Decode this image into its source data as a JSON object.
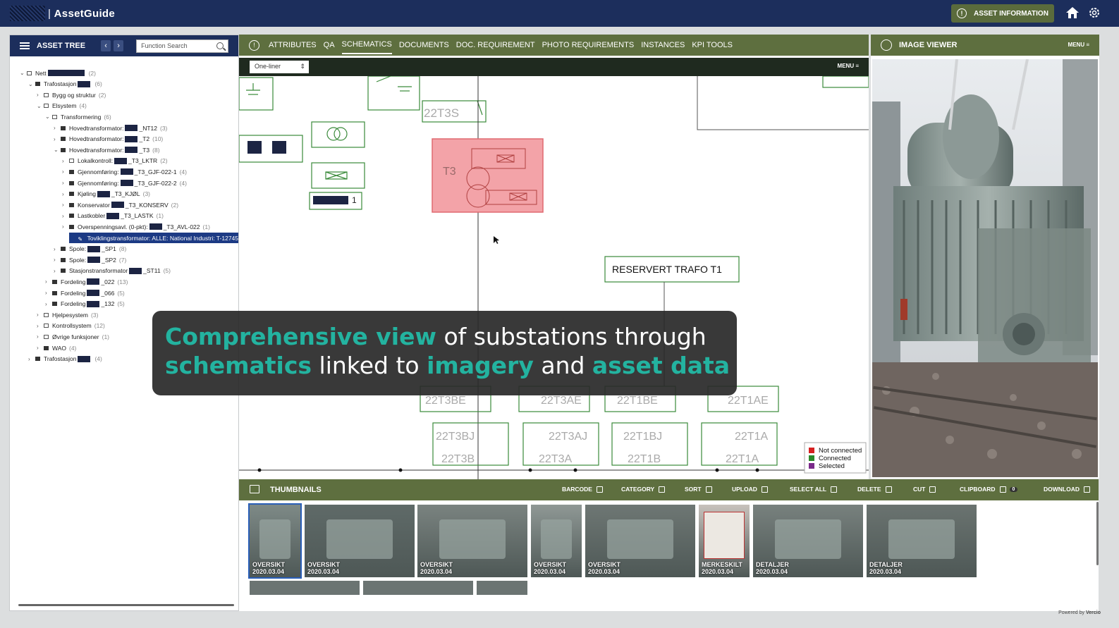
{
  "app": {
    "title": "AssetGuide"
  },
  "header": {
    "asset_info_label": "ASSET INFORMATION"
  },
  "asset_tree": {
    "title": "ASSET TREE",
    "search_placeholder": "Function Search",
    "items": [
      {
        "label": "Nett",
        "count": "(2)"
      },
      {
        "label": "Trafostasjon",
        "count": "(6)"
      },
      {
        "label": "Bygg og struktur",
        "count": "(2)"
      },
      {
        "label": "Elsystem",
        "count": "(4)"
      },
      {
        "label": "Transformering",
        "count": "(6)"
      },
      {
        "label": "Hovedtransformator:",
        "suffix": "_NT12",
        "count": "(3)"
      },
      {
        "label": "Hovedtransformator:",
        "suffix": "_T2",
        "count": "(10)"
      },
      {
        "label": "Hovedtransformator:",
        "suffix": "_T3",
        "count": "(8)"
      },
      {
        "label": "Lokalkontroll:",
        "suffix": "_T3_LKTR",
        "count": "(2)"
      },
      {
        "label": "Gjennomføring:",
        "suffix": "_T3_GJF-022-1",
        "count": "(4)"
      },
      {
        "label": "Gjennomføring:",
        "suffix": "_T3_GJF-022-2",
        "count": "(4)"
      },
      {
        "label": "Kjøling",
        "suffix": "_T3_KJØL",
        "count": "(3)"
      },
      {
        "label": "Konservator",
        "suffix": "_T3_KONSERV",
        "count": "(2)"
      },
      {
        "label": "Lastkobler",
        "suffix": "_T3_LASTK",
        "count": "(1)"
      },
      {
        "label": "Overspenningsavl. (0-pkt):",
        "suffix": "_T3_AVL-022",
        "count": "(1)"
      },
      {
        "label": "Toviklingstransformator: ALLE: National Industri: T-12745",
        "suffix": "",
        "count": ""
      },
      {
        "label": "Spole:",
        "suffix": "_SP1",
        "count": "(8)"
      },
      {
        "label": "Spole:",
        "suffix": "_SP2",
        "count": "(7)"
      },
      {
        "label": "Stasjonstransformator",
        "suffix": "_ST11",
        "count": "(5)"
      },
      {
        "label": "Fordeling",
        "suffix": "_022",
        "count": "(13)"
      },
      {
        "label": "Fordeling",
        "suffix": "_066",
        "count": "(5)"
      },
      {
        "label": "Fordeling",
        "suffix": "_132",
        "count": "(5)"
      },
      {
        "label": "Hjelpesystem",
        "count": "(3)"
      },
      {
        "label": "Kontrollsystem",
        "count": "(12)"
      },
      {
        "label": "Øvrige funksjoner",
        "count": "(1)"
      },
      {
        "label": "WAO",
        "count": "(4)"
      },
      {
        "label": "Trafostasjon",
        "count": "(4)"
      }
    ]
  },
  "tabs": [
    "ATTRIBUTES",
    "QA",
    "SCHEMATICS",
    "DOCUMENTS",
    "DOC. REQUIREMENT",
    "PHOTO REQUIREMENTS",
    "INSTANCES",
    "KPI TOOLS"
  ],
  "schematic": {
    "view_select": "One-liner",
    "menu_label": "MENU",
    "labels": {
      "t3s": "22T3S",
      "t3": "T3",
      "one": "1",
      "reserved": "RESERVERT TRAFO T1",
      "t3be": "22T3BE",
      "t3ae": "22T3AE",
      "t1be": "22T1BE",
      "t1ae": "22T1AE",
      "t3bj": "22T3BJ",
      "t3aj": "22T3AJ",
      "t1bj": "22T1BJ",
      "t1a": "22T1A",
      "t3b": "22T3B",
      "t3a": "22T3A",
      "t1b": "22T1B",
      "t1a2": "22T1A"
    },
    "legend": [
      "Not connected",
      "Connected",
      "Selected"
    ],
    "legend_colors": [
      "#d62020",
      "#2a8a2a",
      "#7a2a8a"
    ]
  },
  "image_viewer": {
    "title": "IMAGE VIEWER",
    "menu_label": "MENU"
  },
  "thumbnails": {
    "title": "THUMBNAILS",
    "actions": [
      "BARCODE",
      "CATEGORY",
      "SORT",
      "UPLOAD",
      "SELECT ALL",
      "DELETE",
      "CUT",
      "CLIPBOARD",
      "DOWNLOAD"
    ],
    "clipboard_count": "0",
    "items": [
      {
        "label": "OVERSIKT",
        "date": "2020.03.04"
      },
      {
        "label": "OVERSIKT",
        "date": "2020.03.04"
      },
      {
        "label": "OVERSIKT",
        "date": "2020.03.04"
      },
      {
        "label": "OVERSIKT",
        "date": "2020.03.04"
      },
      {
        "label": "OVERSIKT",
        "date": "2020.03.04"
      },
      {
        "label": "MERKESKILT",
        "date": "2020.03.04"
      },
      {
        "label": "DETALJER",
        "date": "2020.03.04"
      },
      {
        "label": "DETALJER",
        "date": "2020.03.04"
      }
    ]
  },
  "overlay": {
    "p1": "Comprehensive view",
    "p2": " of substations through",
    "p3": "schematics",
    "p4": " linked to ",
    "p5": "imagery",
    "p6": " and ",
    "p7": "asset data"
  },
  "footer": {
    "powered": "Powered by",
    "brand": "Vercio"
  }
}
